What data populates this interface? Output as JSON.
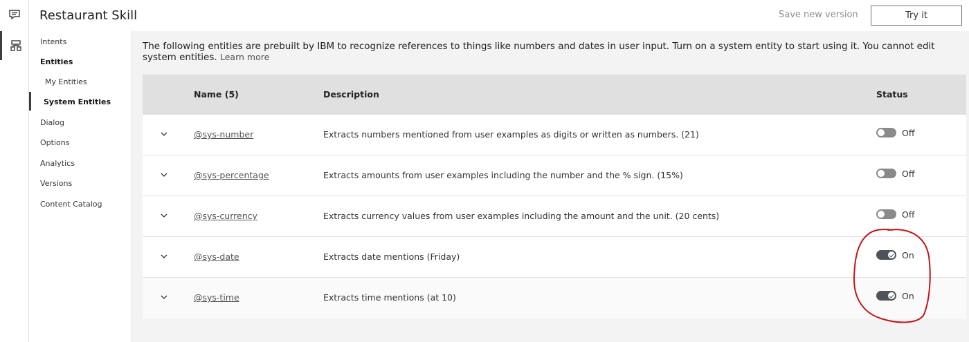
{
  "header": {
    "title": "Restaurant Skill",
    "save_version_label": "Save new version",
    "try_it_label": "Try it"
  },
  "rail": {
    "icons": [
      "chat-icon",
      "skill-icon"
    ]
  },
  "nav": {
    "intents": "Intents",
    "entities": "Entities",
    "my_entities": "My Entities",
    "system_entities": "System Entities",
    "dialog": "Dialog",
    "options": "Options",
    "analytics": "Analytics",
    "versions": "Versions",
    "content_catalog": "Content Catalog"
  },
  "intro": {
    "text": "The following entities are prebuilt by IBM to recognize references to things like numbers and dates in user input. Turn on a system entity to start using it. You cannot edit system entities.",
    "learn_more": "Learn more"
  },
  "table": {
    "headers": {
      "name": "Name (5)",
      "description": "Description",
      "status": "Status"
    },
    "rows": [
      {
        "name": "@sys-number",
        "description": "Extracts numbers mentioned from user examples as digits or written as numbers. (21)",
        "status": "Off",
        "on": false
      },
      {
        "name": "@sys-percentage",
        "description": "Extracts amounts from user examples including the number and the % sign. (15%)",
        "status": "Off",
        "on": false
      },
      {
        "name": "@sys-currency",
        "description": "Extracts currency values from user examples including the amount and the unit. (20 cents)",
        "status": "Off",
        "on": false
      },
      {
        "name": "@sys-date",
        "description": "Extracts date mentions (Friday)",
        "status": "On",
        "on": true
      },
      {
        "name": "@sys-time",
        "description": "Extracts time mentions (at 10)",
        "status": "On",
        "on": true
      }
    ]
  },
  "colors": {
    "toggle_on": "#4d5358",
    "toggle_off": "#8a8a8a",
    "annotation": "#c0161b"
  }
}
